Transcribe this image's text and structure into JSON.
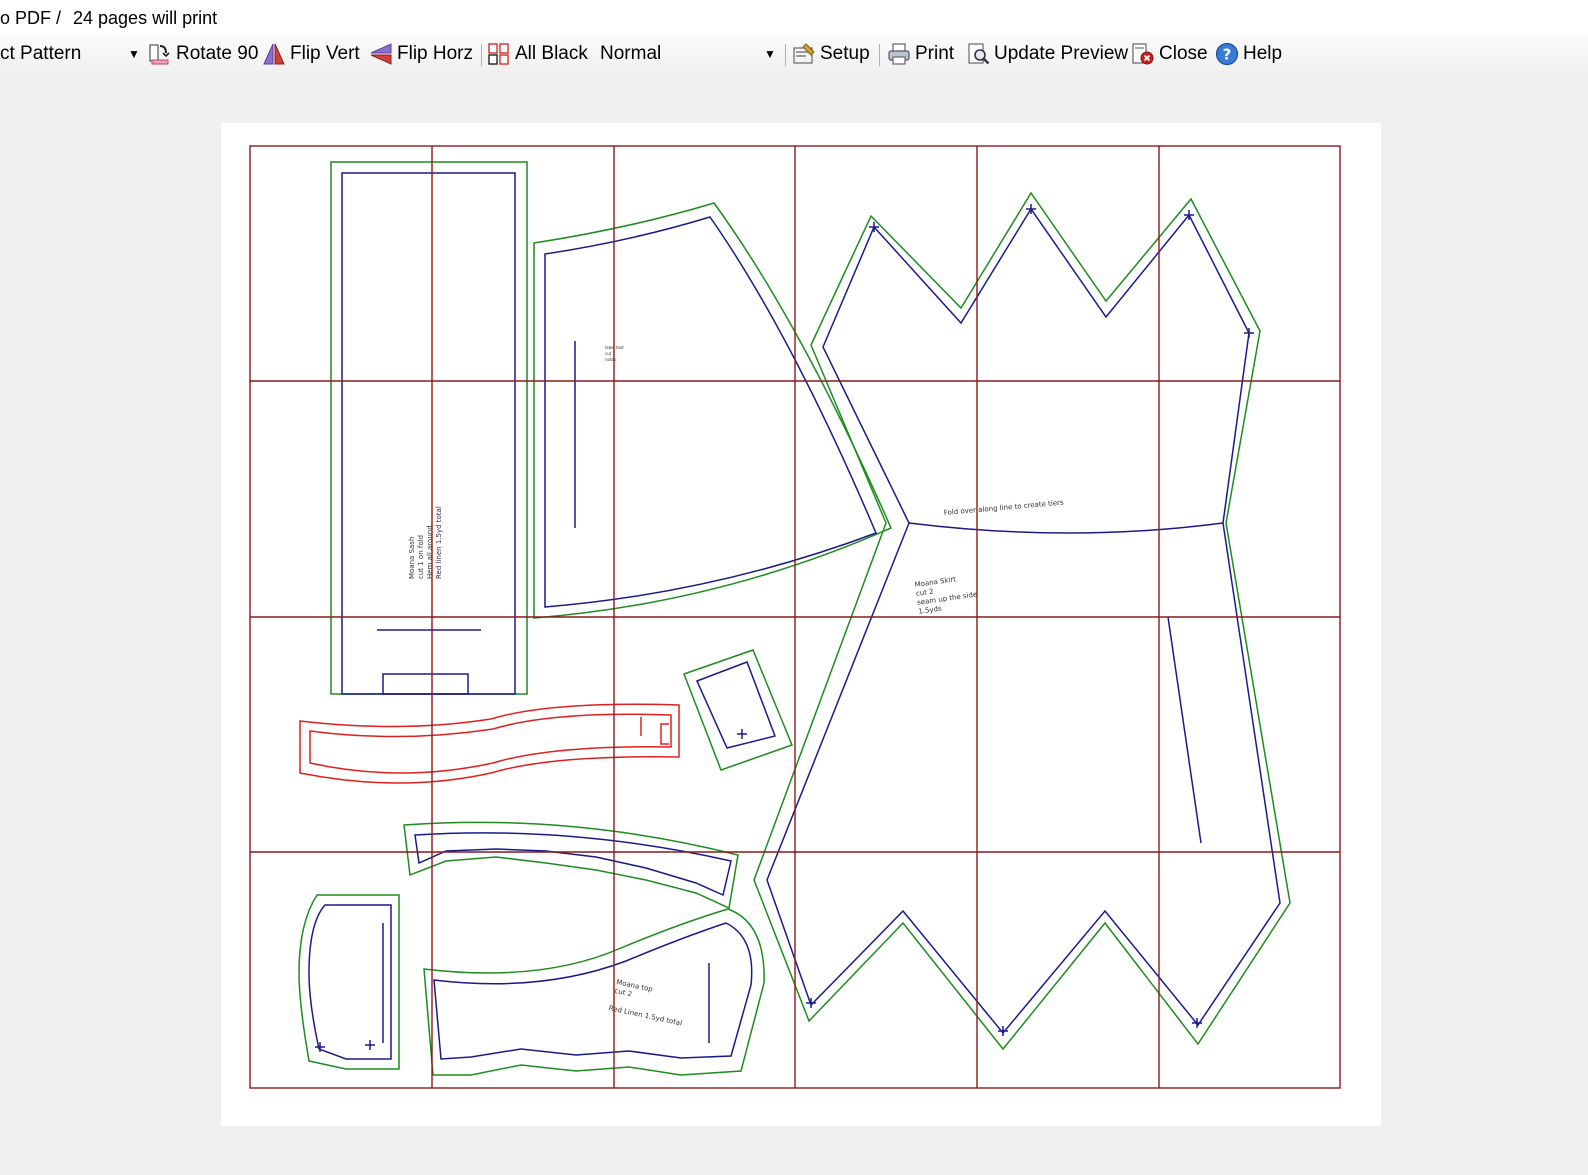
{
  "titlebar": {
    "title_fragment": "o PDF",
    "separator": "/",
    "pages_info": "24 pages will print"
  },
  "toolbar": {
    "pattern_select_value": "ct Pattern",
    "rotate_label": "Rotate 90",
    "flip_vert_label": "Flip Vert",
    "flip_horz_label": "Flip Horz",
    "all_black_label": "All Black",
    "mode_select_value": "Normal",
    "setup_label": "Setup",
    "print_label": "Print",
    "update_preview_label": "Update Preview",
    "close_label": "Close",
    "help_label": "Help"
  },
  "icons": [
    "rotate-icon",
    "flip-vert-icon",
    "flip-horz-icon",
    "all-black-icon",
    "setup-icon",
    "print-icon",
    "update-preview-icon",
    "close-icon",
    "help-icon"
  ],
  "colors": {
    "page_grid": "#8b1a1a",
    "cut_line": "#1a1a8c",
    "seam_allowance": "#1e8c1e",
    "selected_piece": "#e02020"
  },
  "pattern": {
    "sash_label": [
      "Moana Sash",
      "cut 1 on fold",
      "Hem all around",
      "Red linen 1.5yd total"
    ],
    "skirt_label": [
      "Moana Skirt",
      "cut 2",
      "seam up the side",
      "1.5yds"
    ],
    "skirt_fold_note": "Fold over along line to create tiers",
    "top_label": [
      "Moana top",
      "cut 2",
      "Red Linen 1.5yd total"
    ]
  }
}
